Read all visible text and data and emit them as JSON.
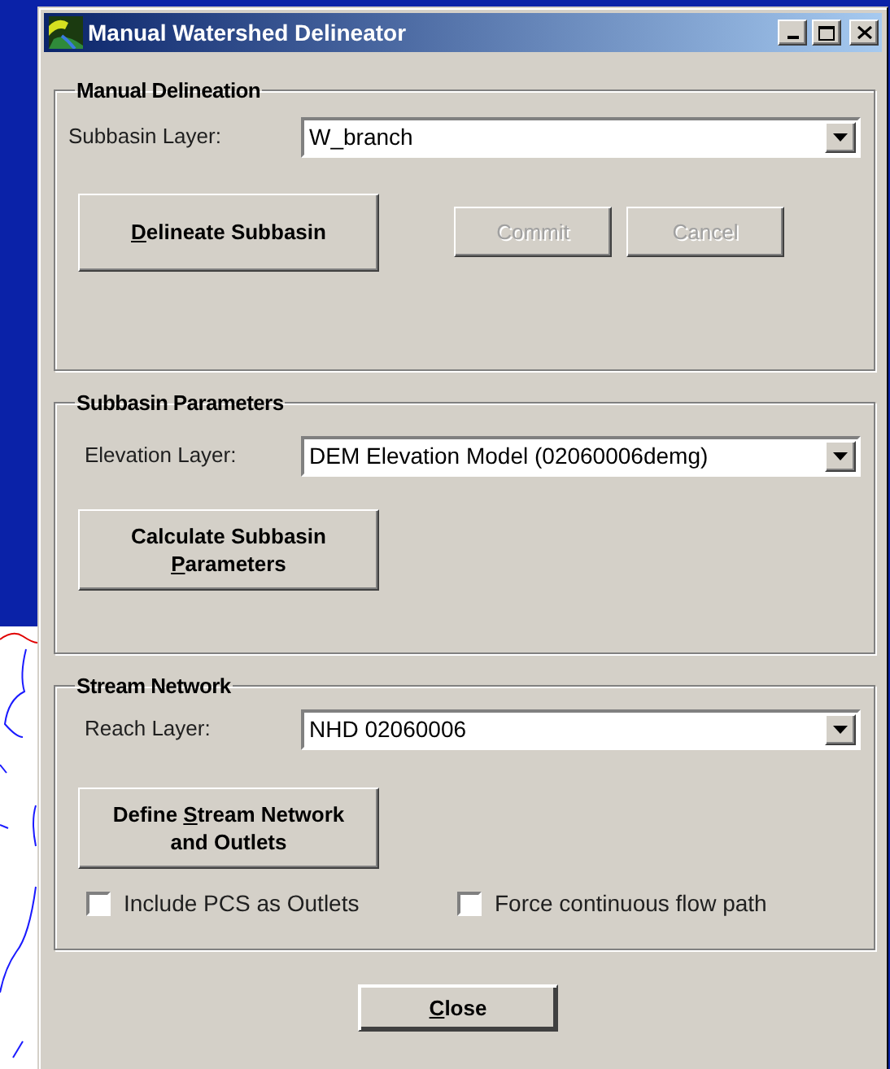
{
  "window": {
    "title": "Manual Watershed Delineator"
  },
  "manual_delineation": {
    "title": "Manual Delineation",
    "layer": {
      "label": "Subbasin Layer:",
      "value": "W_branch"
    },
    "delineate_button": {
      "mnemonic": "D",
      "after": "elineate Subbasin",
      "disabled": false
    },
    "commit_button": {
      "label": "Commit",
      "disabled": true
    },
    "cancel_button": {
      "label": "Cancel",
      "disabled": true
    }
  },
  "subbasin_parameters": {
    "title": "Subbasin Parameters",
    "layer": {
      "label": "Elevation Layer:",
      "value": "DEM Elevation Model (02060006demg)"
    },
    "calculate_button": {
      "before": "Calculate Subbasin ",
      "mnemonic": "P",
      "after": "arameters",
      "disabled": false
    }
  },
  "stream_network": {
    "title": "Stream Network",
    "layer": {
      "label": "Reach Layer:",
      "value": "NHD 02060006"
    },
    "define_button": {
      "before": "Define ",
      "mnemonic": "S",
      "after": "tream Network and Outlets",
      "disabled": false
    },
    "options": [
      {
        "label": "Include PCS as Outlets",
        "checked": false
      },
      {
        "label": "Force continuous flow path",
        "checked": false
      }
    ]
  },
  "close_button": {
    "mnemonic": "C",
    "after": "lose",
    "disabled": false
  }
}
